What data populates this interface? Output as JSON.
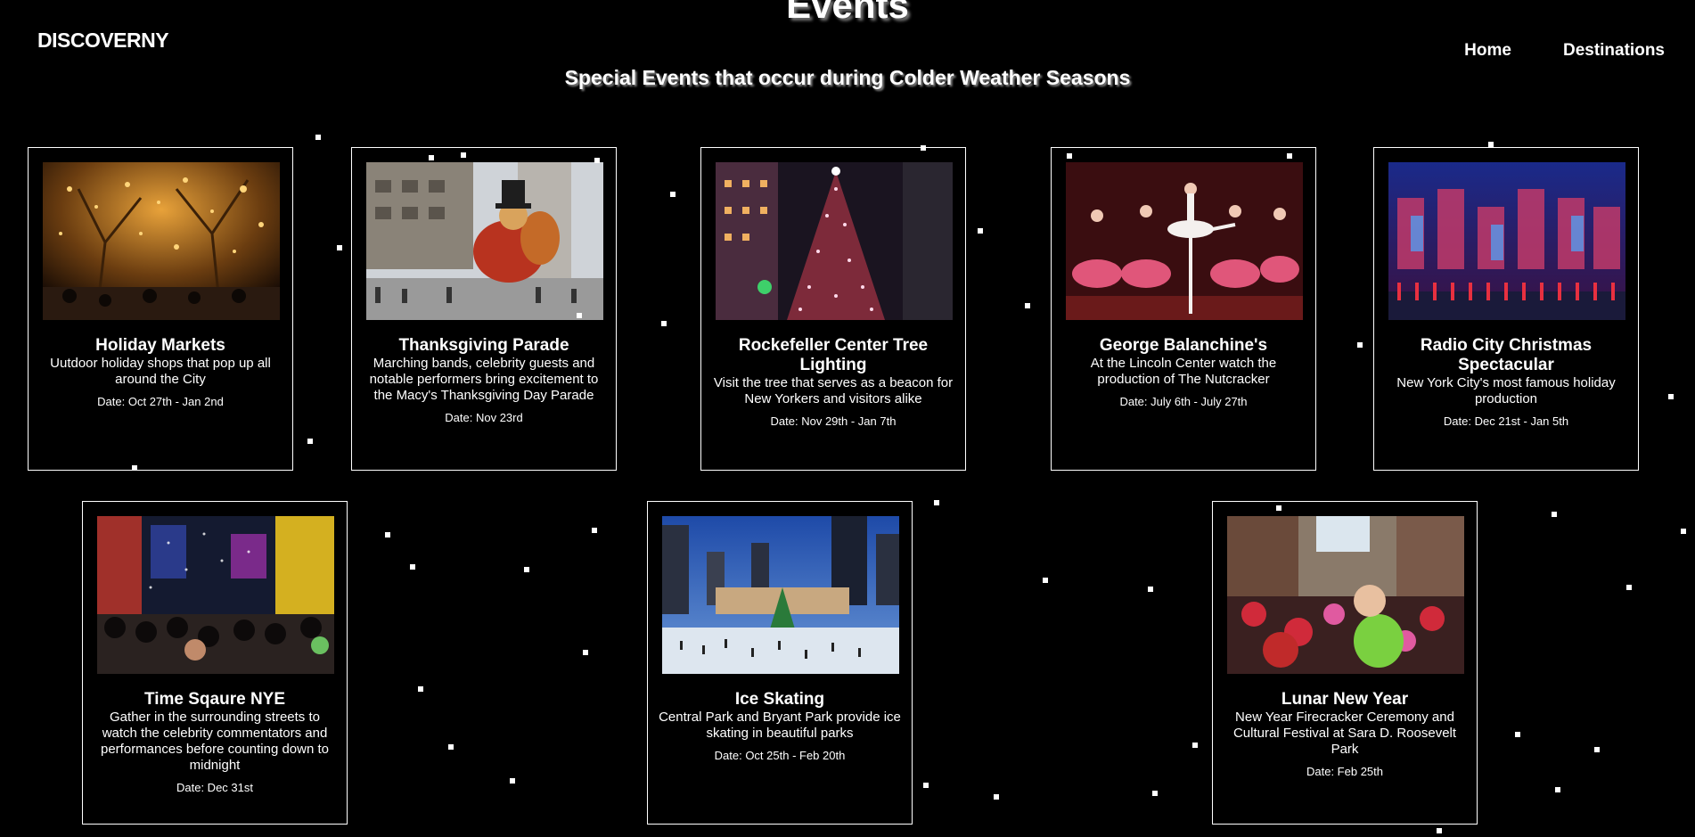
{
  "header": {
    "logo": "DISCOVERNY",
    "nav": [
      {
        "label": "Home"
      },
      {
        "label": "Destinations"
      }
    ]
  },
  "page": {
    "title": "Events",
    "subtitle": "Special Events that occur during Colder Weather Seasons"
  },
  "events": [
    {
      "title": "Holiday Markets",
      "description": "Uutdoor holiday shops that pop up all around the City",
      "date": "Date: Oct 27th - Jan 2nd",
      "image": "holiday-markets-photo"
    },
    {
      "title": "Thanksgiving Parade",
      "description": "Marching bands, celebrity guests and notable performers bring excitement to the Macy's Thanksgiving Day Parade",
      "date": "Date: Nov 23rd",
      "image": "thanksgiving-parade-photo"
    },
    {
      "title": "Rockefeller Center Tree Lighting",
      "description": "Visit the tree that serves as a beacon for New Yorkers and visitors alike",
      "date": "Date: Nov 29th - Jan 7th",
      "image": "rockefeller-tree-photo"
    },
    {
      "title": "George Balanchine's",
      "description": "At the Lincoln Center watch the production of The Nutcracker",
      "date": "Date: July 6th - July 27th",
      "image": "nutcracker-ballet-photo"
    },
    {
      "title": "Radio City Christmas Spectacular",
      "description": "New York City's most famous holiday production",
      "date": "Date: Dec 21st - Jan 5th",
      "image": "radio-city-photo"
    },
    {
      "title": "Time Sqaure NYE",
      "description": "Gather in the surrounding streets to watch the celebrity commentators and performances before counting down to midnight",
      "date": "Date: Dec 31st",
      "image": "times-square-photo"
    },
    {
      "title": "Ice Skating",
      "description": "Central Park and Bryant Park provide ice skating in beautiful parks",
      "date": "Date: Oct 25th - Feb 20th",
      "image": "ice-skating-photo"
    },
    {
      "title": "Lunar New Year",
      "description": "New Year Firecracker Ceremony and Cultural Festival at Sara D. Roosevelt Park",
      "date": "Date: Feb 25th",
      "image": "lunar-new-year-photo"
    }
  ]
}
